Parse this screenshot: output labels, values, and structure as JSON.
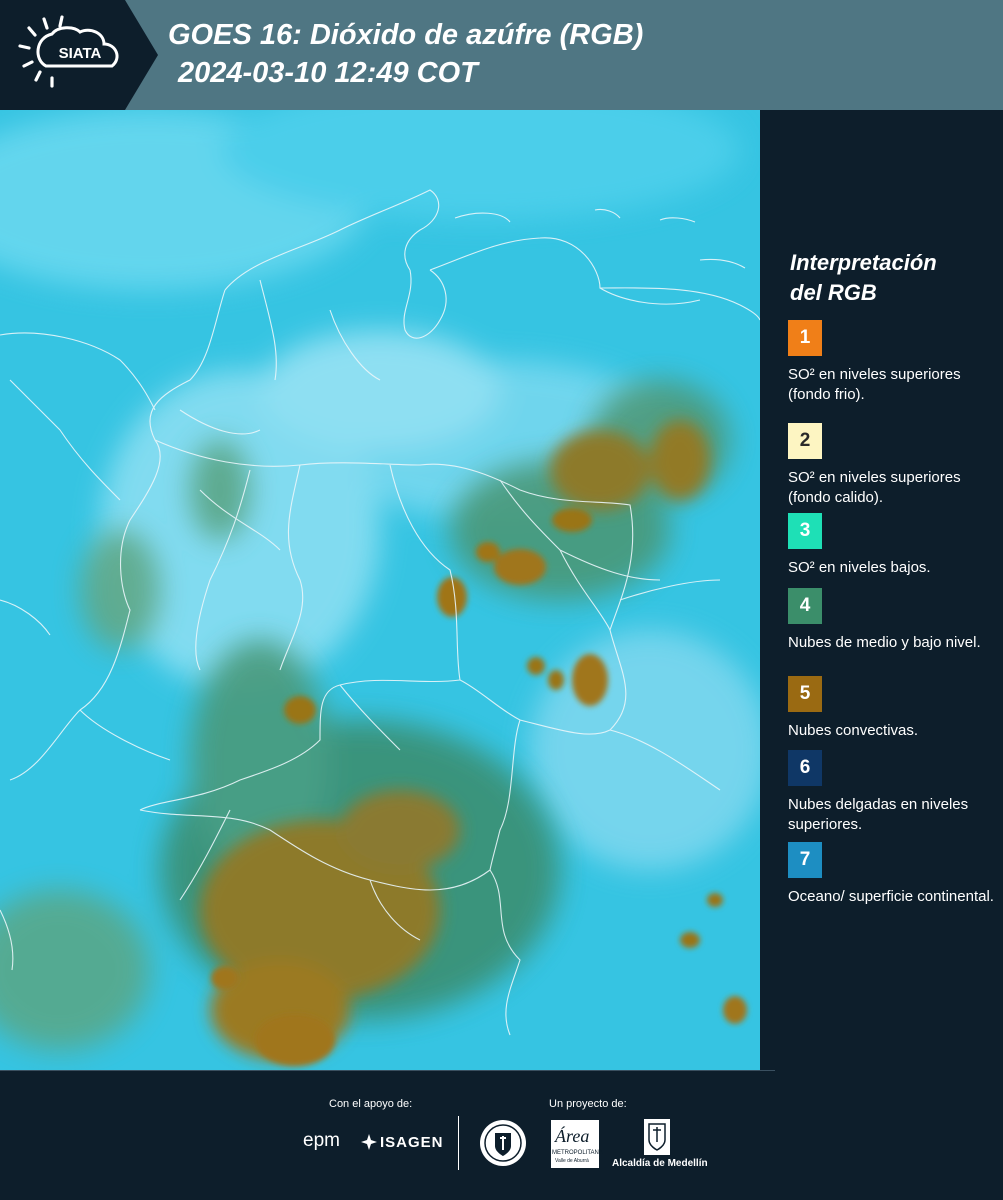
{
  "header": {
    "logo_text": "SIATA",
    "title_line1": "GOES 16: Dióxido de azúfre (RGB)",
    "title_line2": "2024-03-10 12:49 COT"
  },
  "legend": {
    "title_line1": "Interpretación",
    "title_line2": "del RGB",
    "items": [
      {
        "number": "1",
        "label": "SO² en niveles superiores (fondo frio).",
        "color": "#f07f18",
        "text_color": "#ffffff"
      },
      {
        "number": "2",
        "label": "SO² en niveles superiores (fondo calido).",
        "color": "#fdf5c2",
        "text_color": "#2a2a2a"
      },
      {
        "number": "3",
        "label": "SO² en niveles bajos.",
        "color": "#1ee0b6",
        "text_color": "#ffffff"
      },
      {
        "number": "4",
        "label": "Nubes de medio y bajo nivel.",
        "color": "#3b8e6a",
        "text_color": "#ffffff"
      },
      {
        "number": "5",
        "label": "Nubes convectivas.",
        "color": "#9a6a12",
        "text_color": "#ffffff"
      },
      {
        "number": "6",
        "label": "Nubes delgadas en niveles superiores.",
        "color": "#0f3766",
        "text_color": "#ffffff"
      },
      {
        "number": "7",
        "label": "Oceano/ superficie continental.",
        "color": "#1d8ec2",
        "text_color": "#ffffff"
      }
    ]
  },
  "footer": {
    "support_label": "Con el apoyo de:",
    "project_label": "Un proyecto de:",
    "sponsors": [
      "epm",
      "ISAGEN"
    ],
    "partner_area_name": "Área",
    "partner_area_sub": "METROPOLITANA",
    "partner_area_sub2": "Valle de Aburrá",
    "partner_alcaldia": "Alcaldía de Medellín"
  },
  "colors": {
    "header_bg": "#4f7683",
    "panel_bg": "#0d1e2b",
    "map_base": "#33c6e4",
    "land_green": "#3f8e6e",
    "convective": "#9a7a22",
    "border_line": "#e8f4f8"
  }
}
